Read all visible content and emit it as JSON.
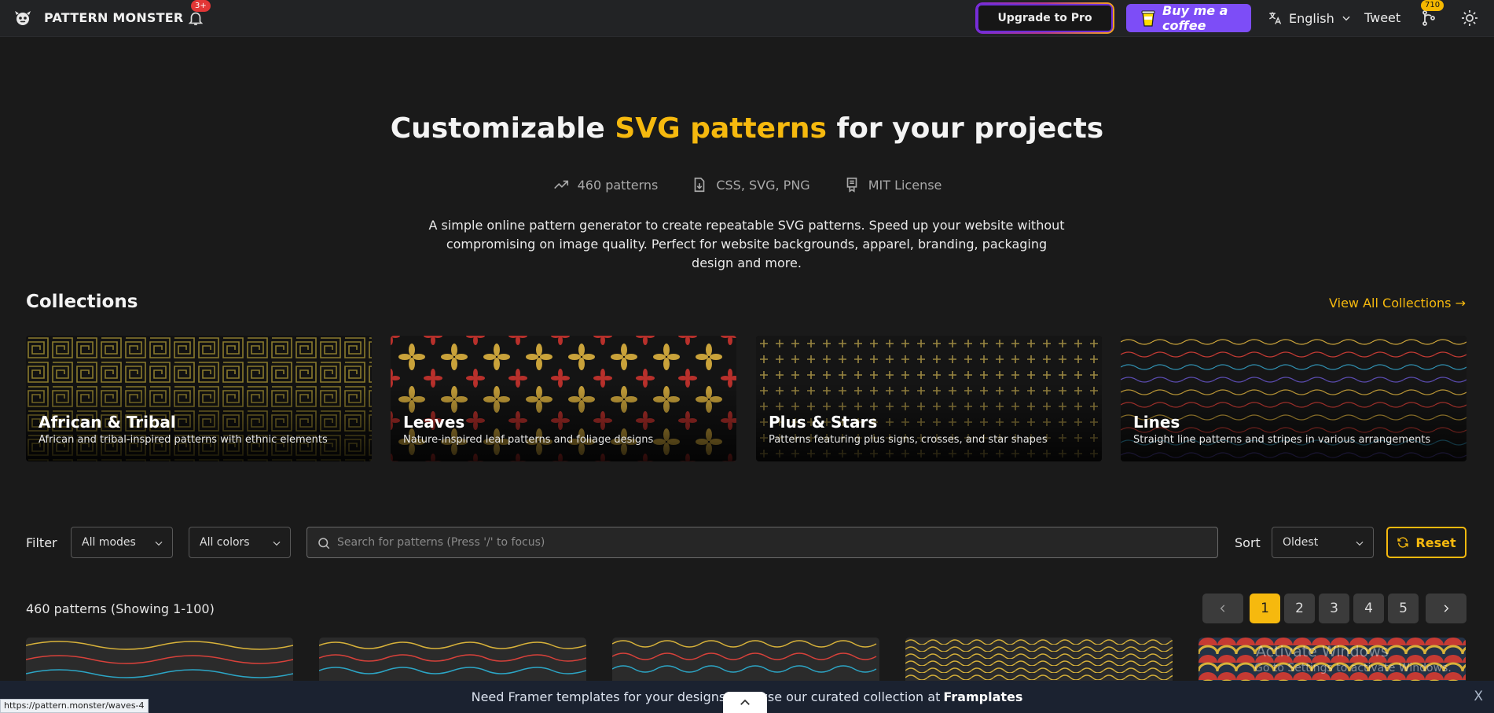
{
  "nav": {
    "brand": "PATTERN MONSTER",
    "notifications_badge": "3+",
    "upgrade_label": "Upgrade to Pro",
    "coffee_label": "Buy me a coffee",
    "language_label": "English",
    "tweet_label": "Tweet",
    "github_count": "710"
  },
  "hero": {
    "title_before": "Customizable ",
    "title_accent": "SVG patterns",
    "title_after": " for your projects",
    "stats": [
      "460 patterns",
      "CSS, SVG, PNG",
      "MIT License"
    ],
    "description": "A simple online pattern generator to create repeatable SVG patterns. Speed up your website without compromising on image quality. Perfect for website backgrounds, apparel, branding, packaging design and more."
  },
  "collections": {
    "title": "Collections",
    "view_all": "View All Collections →",
    "items": [
      {
        "title": "African & Tribal",
        "description": "African and tribal-inspired patterns with ethnic elements"
      },
      {
        "title": "Leaves",
        "description": "Nature-inspired leaf patterns and foliage designs"
      },
      {
        "title": "Plus & Stars",
        "description": "Patterns featuring plus signs, crosses, and star shapes"
      },
      {
        "title": "Lines",
        "description": "Straight line patterns and stripes in various arrangements"
      }
    ]
  },
  "filters": {
    "label": "Filter",
    "mode_value": "All modes",
    "color_value": "All colors",
    "search_placeholder": "Search for patterns (Press '/' to focus)",
    "sort_label": "Sort",
    "sort_value": "Oldest",
    "reset_label": "Reset"
  },
  "results": {
    "count": "460 patterns (Showing 1-100)",
    "pages": [
      "1",
      "2",
      "3",
      "4",
      "5"
    ],
    "current_page": "1"
  },
  "banner": {
    "text": "Need Framer templates for your designs? Browse our curated collection at",
    "link": "Framplates",
    "close": "X"
  },
  "status_bar_url": "https://pattern.monster/waves-4",
  "os_watermark": {
    "line1": "Activate Windows",
    "line2": "Go to Settings to activate Windows."
  },
  "colors": {
    "accent": "#f6b90e",
    "background": "#1a1a1a",
    "coffee": "#7d4df7",
    "badge_red": "#e23636"
  }
}
